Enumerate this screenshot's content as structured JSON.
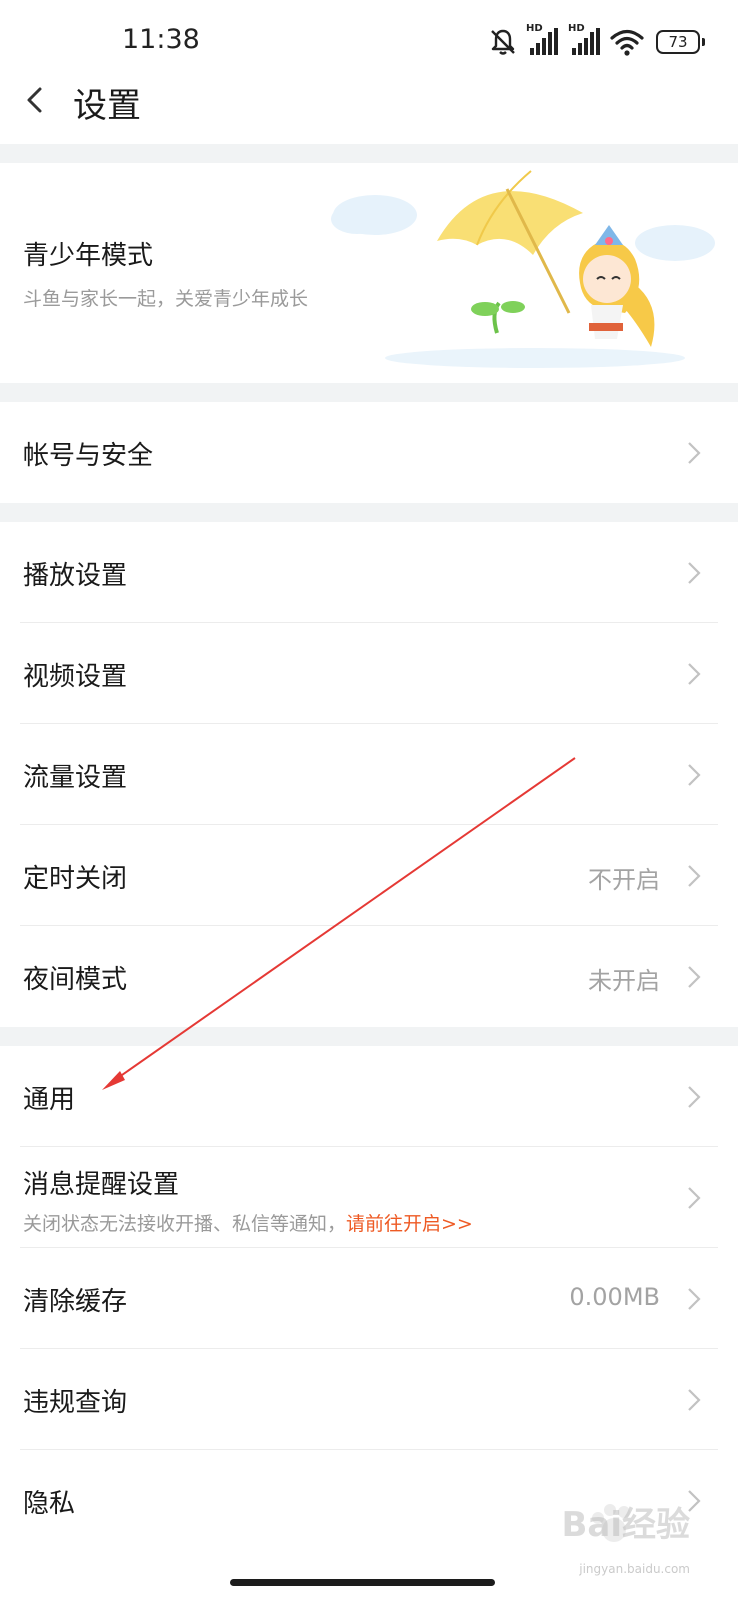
{
  "status_bar": {
    "time": "11:38",
    "hd_labels": [
      "HD",
      "HD"
    ],
    "battery": "73",
    "icons": [
      "bell-muted-icon",
      "signal-icon",
      "signal-icon",
      "wifi-icon",
      "battery-icon"
    ]
  },
  "header": {
    "title": "设置",
    "back_icon": "chevron-left-icon"
  },
  "youth_banner": {
    "title": "青少年模式",
    "subtitle": "斗鱼与家长一起，关爱青少年成长",
    "illustration": "girl-with-umbrella-illustration"
  },
  "sections": [
    {
      "items": [
        {
          "label": "帐号与安全"
        }
      ]
    },
    {
      "items": [
        {
          "label": "播放设置"
        },
        {
          "label": "视频设置"
        },
        {
          "label": "流量设置"
        },
        {
          "label": "定时关闭",
          "value": "不开启"
        },
        {
          "label": "夜间模式",
          "value": "未开启"
        }
      ]
    },
    {
      "items": [
        {
          "label": "通用"
        },
        {
          "label": "消息提醒设置",
          "subtitle": "关闭状态无法接收开播、私信等通知，",
          "link": "请前往开启>>"
        },
        {
          "label": "清除缓存",
          "value": "0.00MB"
        },
        {
          "label": "违规查询"
        },
        {
          "label": "隐私"
        }
      ]
    }
  ],
  "watermark": {
    "text": "Bai经验",
    "sub": "jingyan.baidu.com"
  },
  "colors": {
    "accent": "#ee5a24",
    "annotation_arrow": "#e53935",
    "separator": "#f1f3f4"
  }
}
